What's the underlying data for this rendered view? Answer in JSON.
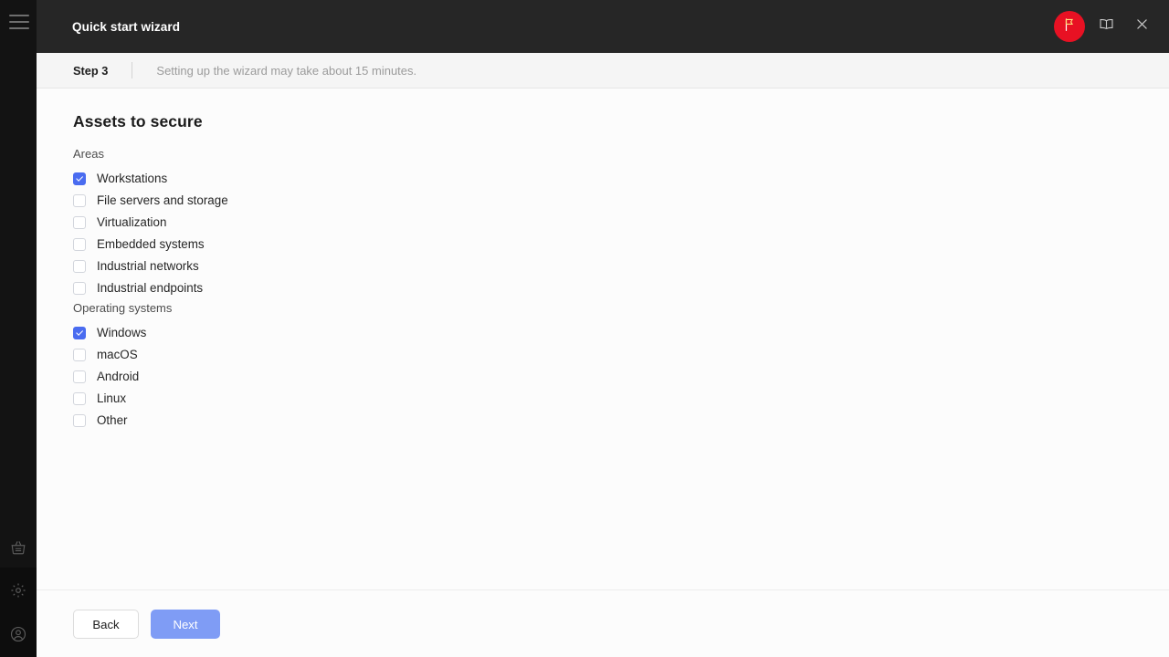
{
  "window": {
    "title": "Quick start wizard",
    "actions": [
      {
        "name": "flag-badge",
        "icon": "flag-icon",
        "color": "#e81123"
      },
      {
        "name": "help-book-button",
        "icon": "book-icon"
      },
      {
        "name": "close-button",
        "icon": "close-icon"
      }
    ]
  },
  "rail": {
    "menu_icon": "hamburger-menu-icon",
    "items": [
      {
        "icon": "basket-icon",
        "name": "rail-item-basket"
      },
      {
        "icon": "gear-icon",
        "name": "rail-item-settings"
      },
      {
        "icon": "user-icon",
        "name": "rail-item-account"
      }
    ]
  },
  "stepbar": {
    "step": "Step 3",
    "hint": "Setting up the wizard may take about 15 minutes."
  },
  "main": {
    "title": "Assets to secure",
    "groups": [
      {
        "label": "Areas",
        "options": [
          {
            "label": "Workstations",
            "checked": true
          },
          {
            "label": "File servers and storage",
            "checked": false
          },
          {
            "label": "Virtualization",
            "checked": false
          },
          {
            "label": "Embedded systems",
            "checked": false
          },
          {
            "label": "Industrial networks",
            "checked": false
          },
          {
            "label": "Industrial endpoints",
            "checked": false
          }
        ]
      },
      {
        "label": "Operating systems",
        "options": [
          {
            "label": "Windows",
            "checked": true
          },
          {
            "label": "macOS",
            "checked": false
          },
          {
            "label": "Android",
            "checked": false
          },
          {
            "label": "Linux",
            "checked": false
          },
          {
            "label": "Other",
            "checked": false
          }
        ]
      }
    ]
  },
  "footer": {
    "back_label": "Back",
    "next_label": "Next",
    "next_disabled": true
  },
  "colors": {
    "accent_checked": "#4a6cf0",
    "next_button": "#7f9cf5",
    "flag_badge": "#e81123",
    "titlebar": "#262626",
    "rail": "#0d0d0d"
  }
}
